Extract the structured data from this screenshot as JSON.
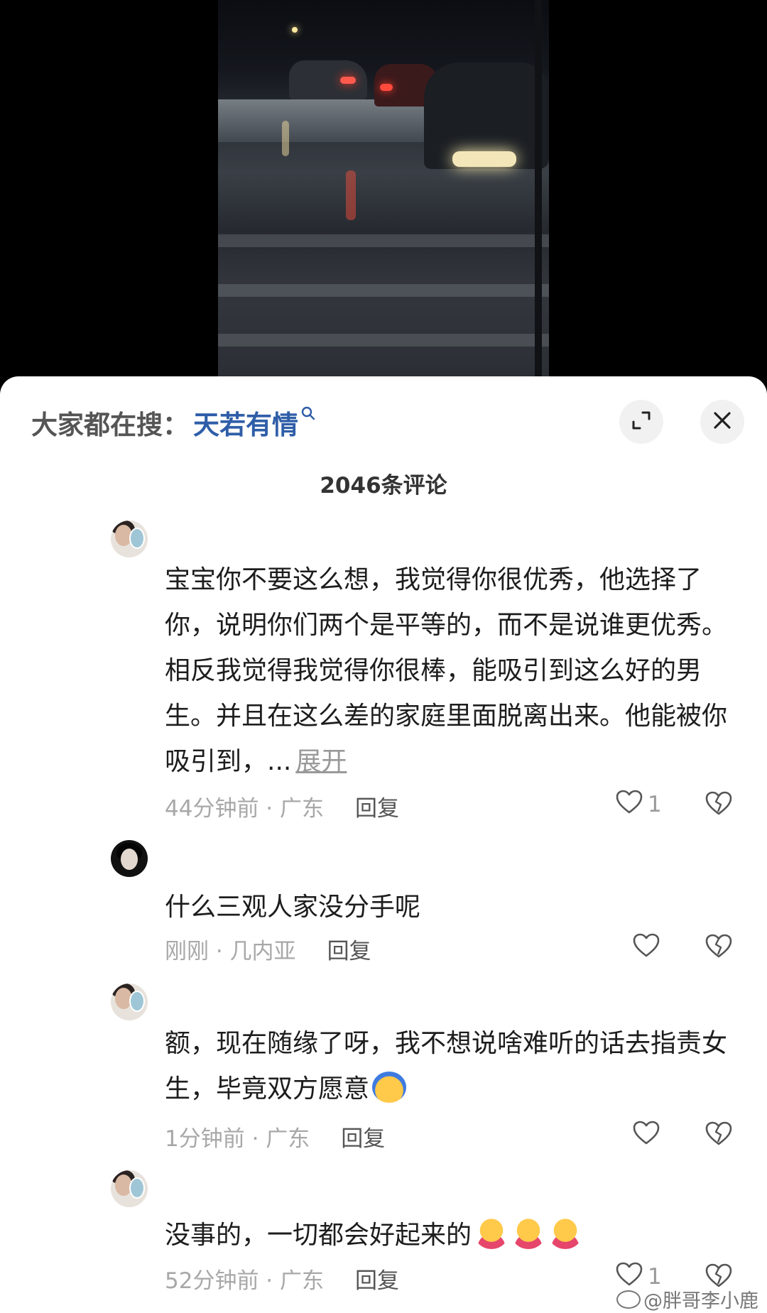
{
  "video": {
    "label": ""
  },
  "search": {
    "label": "大家都在搜：",
    "term": "天若有情",
    "icon": "search-icon"
  },
  "buttons": {
    "expand_icon": "expand-icon",
    "close_icon": "close-icon"
  },
  "comment_count": "2046条评论",
  "comments": [
    {
      "avatar": "avatar-woman-badge",
      "text": "宝宝你不要这么想，我觉得你很优秀，他选择了你，说明你们两个是平等的，而不是说谁更优秀。相反我觉得我觉得你很棒，能吸引到这么好的男生。并且在这么差的家庭里面脱离出来。他能被你吸引到，...",
      "more": "展开",
      "meta": "44分钟前 · 广东",
      "reply": "回复",
      "likes": "1"
    },
    {
      "avatar": "avatar-dark",
      "text": "什么三观人家没分手呢",
      "meta": "刚刚 · 几内亚",
      "reply": "回复",
      "likes": ""
    },
    {
      "avatar": "avatar-woman-badge",
      "text": "额，现在随缘了呀，我不想说啥难听的话去指责女生，毕竟双方愿意",
      "meta": "1分钟前 · 广东",
      "reply": "回复",
      "likes": "",
      "emoji": "cool-emoji"
    },
    {
      "avatar": "avatar-woman-badge",
      "text": "没事的，一切都会好起来的",
      "meta": "52分钟前 · 广东",
      "reply": "回复",
      "likes": "1",
      "emoji": "hug-emoji"
    }
  ],
  "watermark": "@胖哥李小鹿",
  "colors": {
    "link_blue": "#2f5ea8",
    "meta_gray": "#a8a8a8",
    "sheet_bg": "#ffffff"
  }
}
